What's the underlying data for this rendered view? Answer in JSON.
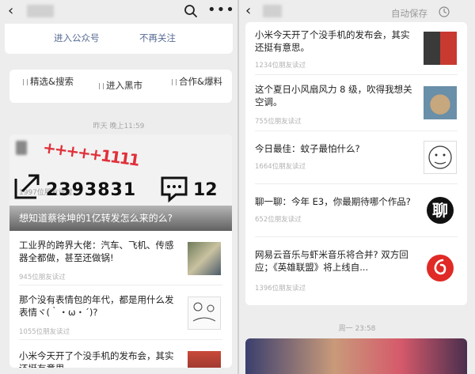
{
  "left": {
    "header": {
      "back_icon": "‹",
      "search_icon": "search-icon",
      "more_icon": "more-icon"
    },
    "actions": {
      "follow": "进入公众号",
      "unfollow": "不再关注"
    },
    "menu": [
      {
        "label": "精选&搜索"
      },
      {
        "label": "进入黑市"
      },
      {
        "label": "合作&爆料"
      }
    ],
    "timestamp": "昨天 晚上11:59",
    "banner": {
      "reads": "1997位朋友读过",
      "big_number": "2393831",
      "side_number": "12",
      "plus_marks": "+++++1111",
      "headline": "想知道蔡徐坤的1亿转发怎么来的么?"
    },
    "articles": [
      {
        "title": "工业界的跨界大佬：汽车、飞机、传感器全都做，甚至还做锅!",
        "reads": "945位朋友读过"
      },
      {
        "title": "那个没有表情包的年代，都是用什么发表情ヾ(｀・ω・´)?",
        "reads": "1055位朋友读过"
      },
      {
        "title": "小米今天开了个没手机的发布会，其实还挺有意思",
        "reads": ""
      }
    ]
  },
  "right": {
    "header": {
      "back_icon": "‹",
      "autosave": "自动保存",
      "clock_icon": "clock-icon"
    },
    "articles": [
      {
        "title": "小米今天开了个没手机的发布会，其实还挺有意思。",
        "reads": "1234位朋友读过"
      },
      {
        "title": "这个夏日小风扇风力 8 级，吹得我想关空调。",
        "reads": "755位朋友读过"
      },
      {
        "title": "今日最佳：蚊子最怕什么?",
        "reads": "1664位朋友读过"
      },
      {
        "title": "聊一聊：今年 E3，你最期待哪个作品?",
        "reads": "652位朋友读过",
        "thumb_text": "聊"
      },
      {
        "title": "网易云音乐与虾米音乐将合并? 双方回应；《英雄联盟》将上线自...",
        "reads": "1396位朋友读过"
      }
    ],
    "timestamp": "周一 23:58"
  }
}
